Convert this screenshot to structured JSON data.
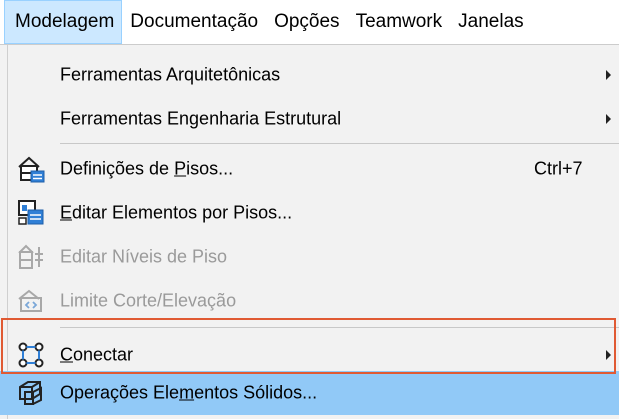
{
  "menubar": {
    "items": [
      {
        "label": "Modelagem"
      },
      {
        "label": "Documentação"
      },
      {
        "label": "Opções"
      },
      {
        "label": "Teamwork"
      },
      {
        "label": "Janelas"
      }
    ]
  },
  "menu": {
    "items": [
      {
        "label": "Ferramentas Arquitetônicas",
        "submenu": true
      },
      {
        "label": "Ferramentas Engenharia Estrutural",
        "submenu": true
      },
      {
        "label_pre": "Definições de ",
        "label_ul": "P",
        "label_post": "isos...",
        "shortcut": "Ctrl+7",
        "icon": "story-settings-icon"
      },
      {
        "label_pre": "",
        "label_ul": "E",
        "label_post": "ditar Elementos por Pisos...",
        "icon": "edit-elements-by-stories-icon"
      },
      {
        "label": "Editar Níveis de Piso",
        "disabled": true,
        "icon": "edit-story-levels-icon"
      },
      {
        "label": "Limite Corte/Elevação",
        "disabled": true,
        "icon": "section-elevation-limit-icon"
      },
      {
        "label_pre": "",
        "label_ul": "C",
        "label_post": "onectar",
        "submenu": true,
        "icon": "connect-icon"
      },
      {
        "label_pre": "Operações Ele",
        "label_ul": "m",
        "label_post": "entos Sólidos...",
        "highlighted": true,
        "icon": "solid-element-operations-icon"
      }
    ]
  },
  "colors": {
    "menubar_active_bg": "#cce8ff",
    "menu_bg": "#f2f2f2",
    "highlight_bg": "#91c9f7",
    "highlight_frame": "#e05a33",
    "disabled_text": "#9a9a9a"
  }
}
